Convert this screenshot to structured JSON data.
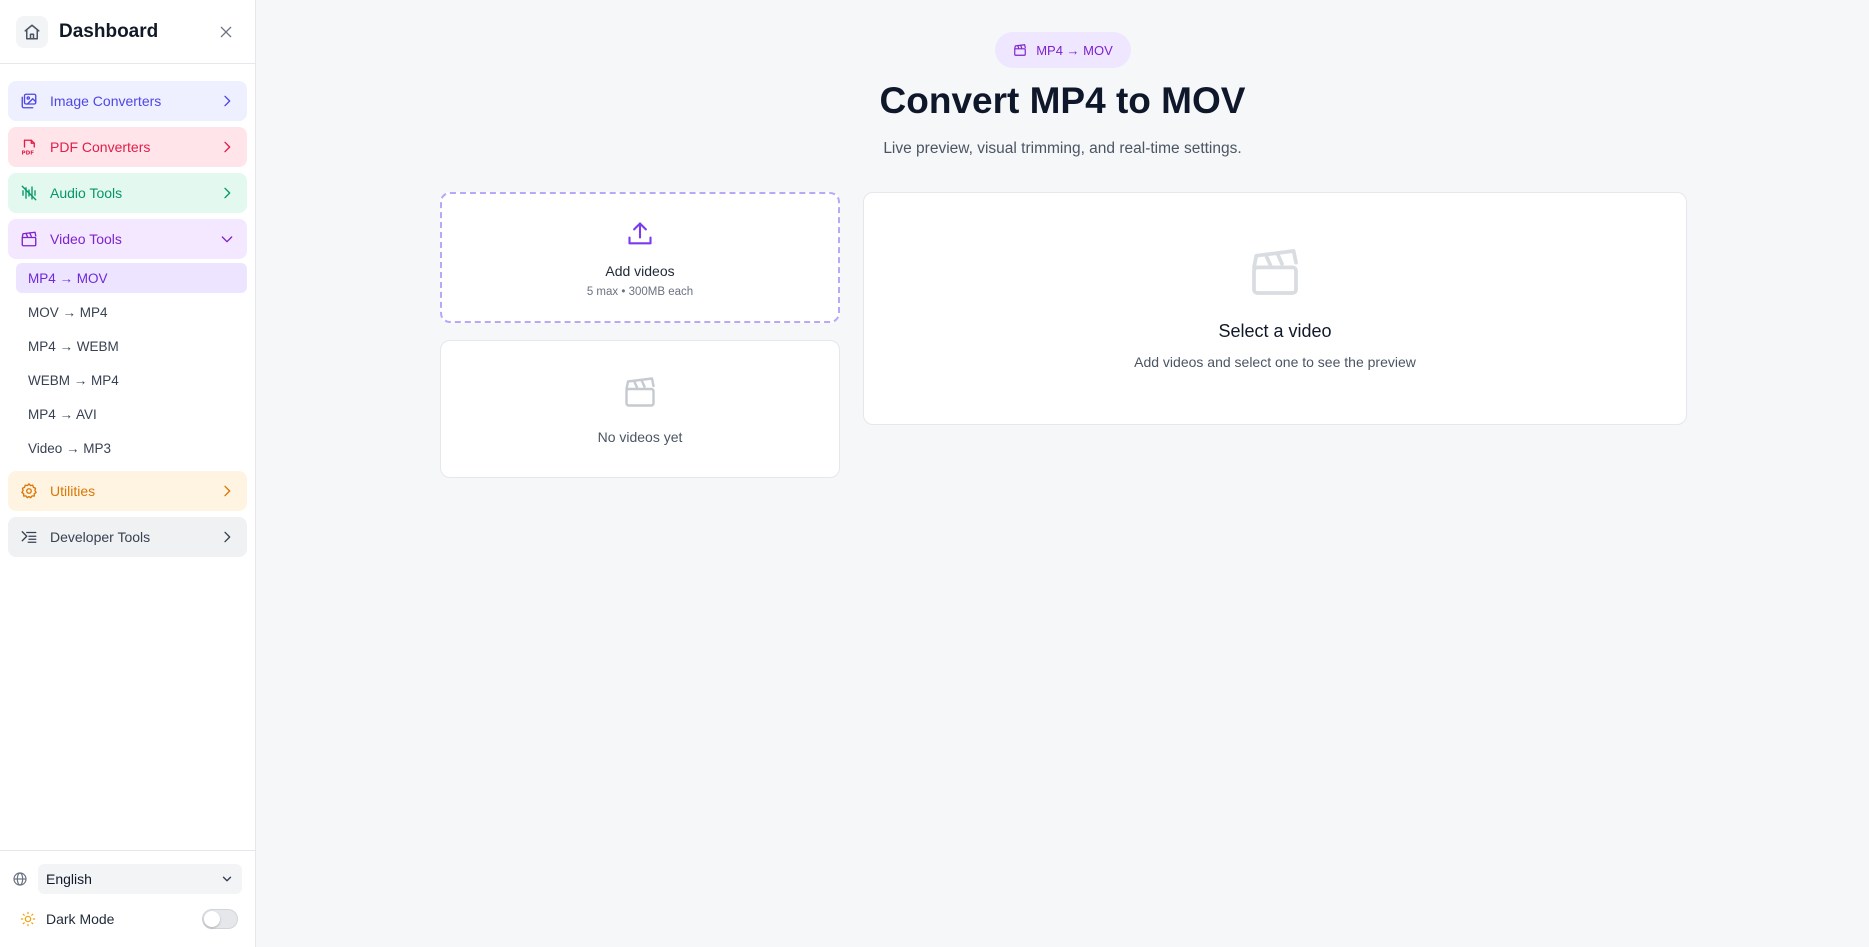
{
  "sidebar": {
    "title": "Dashboard",
    "categories": [
      {
        "label": "Image Converters",
        "icon": "image-icon",
        "color": "#4f46e5"
      },
      {
        "label": "PDF Converters",
        "icon": "pdf-icon",
        "color": "#e11d48"
      },
      {
        "label": "Audio Tools",
        "icon": "audio-wave-icon",
        "color": "#059669"
      },
      {
        "label": "Video Tools",
        "icon": "clapperboard-icon",
        "color": "#7e22ce",
        "expanded": true
      },
      {
        "label": "Utilities",
        "icon": "gear-icon",
        "color": "#d97706"
      },
      {
        "label": "Developer Tools",
        "icon": "terminal-icon",
        "color": "#374151"
      }
    ],
    "video_items": [
      {
        "label": "MP4 → MOV",
        "active": true
      },
      {
        "label": "MOV → MP4"
      },
      {
        "label": "MP4 → WEBM"
      },
      {
        "label": "WEBM → MP4"
      },
      {
        "label": "MP4 → AVI"
      },
      {
        "label": "Video → MP3"
      }
    ],
    "footer": {
      "language": "English",
      "dark_mode_label": "Dark Mode",
      "dark_mode_on": false
    }
  },
  "main": {
    "badge": "MP4 → MOV",
    "title": "Convert MP4 to MOV",
    "subtitle": "Live preview, visual trimming, and real-time settings.",
    "dropzone": {
      "label": "Add videos",
      "limit": "5 max • 300MB each"
    },
    "list": {
      "empty_text": "No videos yet"
    },
    "preview": {
      "title": "Select a video",
      "subtitle": "Add videos and select one to see the preview"
    }
  },
  "colors": {
    "accent": "#7c3aed",
    "active_bg": "#ede4ff"
  }
}
